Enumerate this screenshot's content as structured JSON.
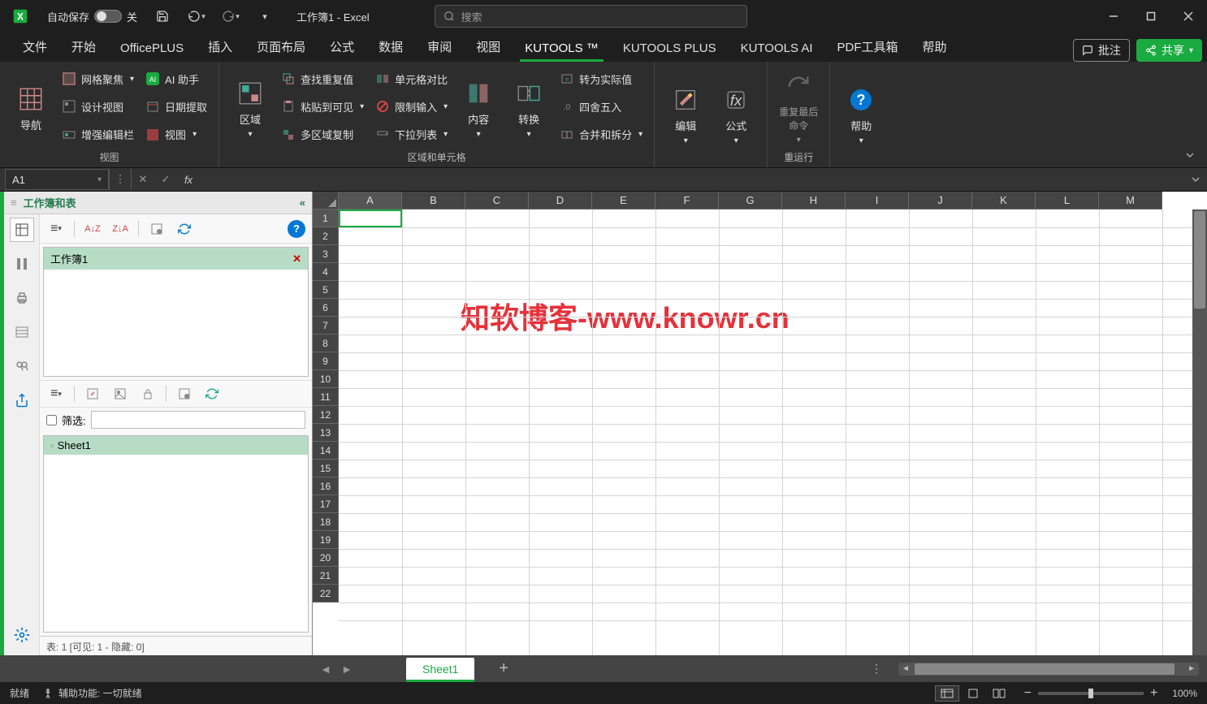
{
  "titlebar": {
    "autosave_label": "自动保存",
    "autosave_state": "关",
    "doc_title": "工作簿1 - Excel",
    "search_placeholder": "搜索"
  },
  "tabs": {
    "file": "文件",
    "home": "开始",
    "officeplus": "OfficePLUS",
    "insert": "插入",
    "layout": "页面布局",
    "formula": "公式",
    "data": "数据",
    "review": "审阅",
    "view": "视图",
    "kutools": "KUTOOLS ™",
    "kutools_plus": "KUTOOLS PLUS",
    "kutools_ai": "KUTOOLS AI",
    "pdf": "PDF工具箱",
    "help": "帮助",
    "comments": "批注",
    "share": "共享"
  },
  "ribbon": {
    "nav": "导航",
    "grid_focus": "网格聚焦",
    "ai_helper": "AI 助手",
    "design_view": "设计视图",
    "date_extract": "日期提取",
    "enhance_editbar": "增强编辑栏",
    "view_btn": "视图",
    "group_view": "视图",
    "area": "区域",
    "find_dup": "查找重复值",
    "cell_compare": "单元格对比",
    "paste_visible": "粘贴到可见",
    "limit_input": "限制输入",
    "multi_area_copy": "多区域复制",
    "dropdown": "下拉列表",
    "group_area": "区域和单元格",
    "content": "内容",
    "convert": "转换",
    "to_actual": "转为实际值",
    "round": "四舍五入",
    "merge_split": "合并和拆分",
    "edit": "编辑",
    "formula_btn": "公式",
    "redo_last": "重复最后\n命令",
    "group_rerun": "重运行",
    "help_btn": "帮助"
  },
  "fbar": {
    "cell": "A1"
  },
  "sidepanel": {
    "title": "工作簿和表",
    "workbook": "工作簿1",
    "filter_label": "筛选:",
    "sheet": "Sheet1",
    "status": "表: 1  [可见: 1 - 隐藏: 0]"
  },
  "grid": {
    "cols": [
      "A",
      "B",
      "C",
      "D",
      "E",
      "F",
      "G",
      "H",
      "I",
      "J",
      "K",
      "L",
      "M"
    ],
    "rows": [
      1,
      2,
      3,
      4,
      5,
      6,
      7,
      8,
      9,
      10,
      11,
      12,
      13,
      14,
      15,
      16,
      17,
      18,
      19,
      20,
      21,
      22
    ],
    "watermark": "知软博客-www.knowr.cn"
  },
  "sheettab": {
    "sheet1": "Sheet1"
  },
  "statusbar": {
    "ready": "就绪",
    "a11y": "辅助功能: 一切就绪",
    "zoom": "100%"
  }
}
